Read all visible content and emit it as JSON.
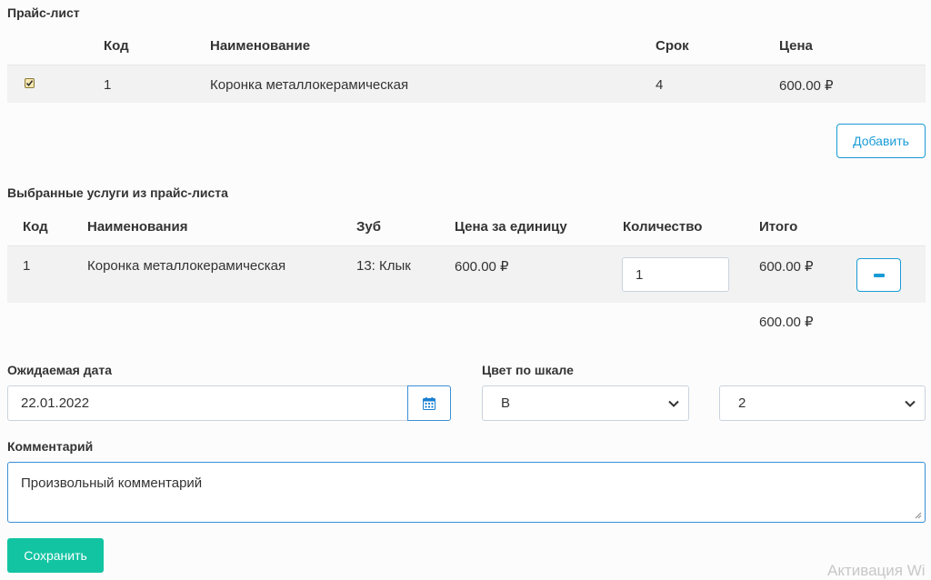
{
  "price_list": {
    "title": "Прайс-лист",
    "columns": [
      "Код",
      "Наименование",
      "Срок",
      "Цена"
    ],
    "rows": [
      {
        "checked": true,
        "code": "1",
        "name": "Коронка металлокерамическая",
        "term": "4",
        "price": "600.00 ₽"
      }
    ],
    "add_button": "Добавить"
  },
  "selected": {
    "title": "Выбранные услуги из прайс-листа",
    "columns": [
      "Код",
      "Наименования",
      "Зуб",
      "Цена за единицу",
      "Количество",
      "Итого"
    ],
    "rows": [
      {
        "code": "1",
        "name": "Коронка металлокерамическая",
        "tooth": "13: Клык",
        "unit_price": "600.00 ₽",
        "quantity": "1",
        "total": "600.00 ₽"
      }
    ],
    "grand_total": "600.00 ₽"
  },
  "form": {
    "date_label": "Ожидаемая дата",
    "date_value": "22.01.2022",
    "color_label": "Цвет по шкале",
    "color_letter": "B",
    "color_number": "2",
    "comment_label": "Комментарий",
    "comment_value": "Произвольный комментарий",
    "save_button": "Сохранить"
  },
  "watermark": "Активация Wi"
}
